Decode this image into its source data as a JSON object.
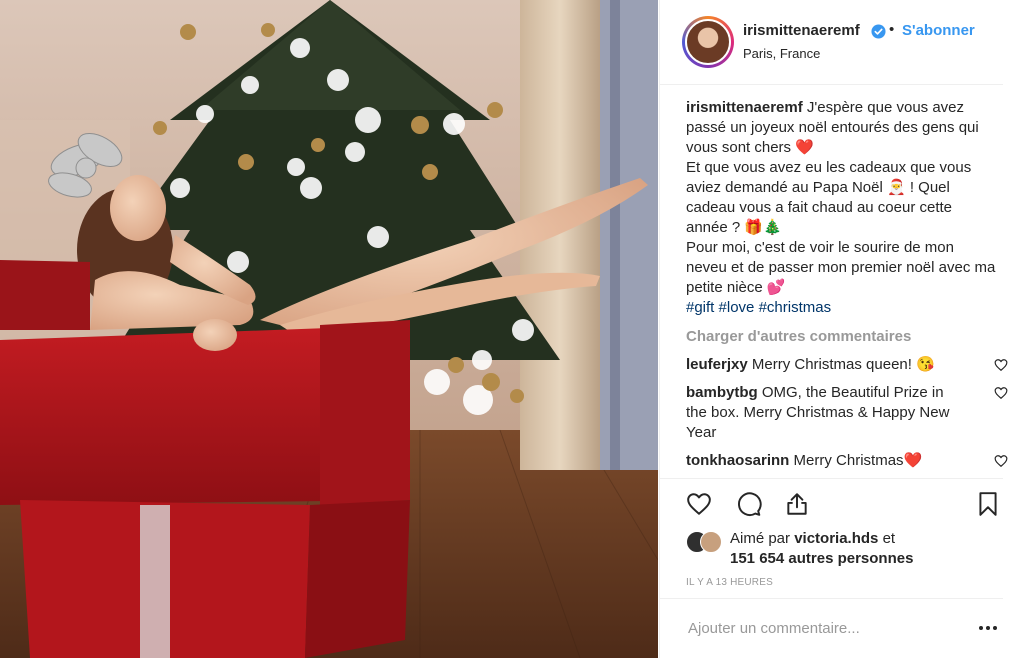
{
  "post": {
    "username": "irismittenaeremf",
    "follow_label": "S'abonner",
    "dot": "•",
    "location": "Paris, France"
  },
  "caption": {
    "username": "irismittenaeremf",
    "line1": "J'espère que vous avez passé un joyeux noël entourés des gens qui vous sont chers ❤️",
    "line2": "Et que vous avez eu les cadeaux que vous aviez demandé au Papa Noël 🎅 ! Quel cadeau vous a fait chaud au coeur cette année ? 🎁🎄",
    "line3": "Pour moi, c'est de voir le sourire de mon neveu et de passer mon premier noël avec ma petite nièce 💕",
    "hashtags": [
      "#gift",
      "#love",
      "#christmas"
    ]
  },
  "load_more_label": "Charger d'autres commentaires",
  "comments": [
    {
      "username": "leuferjxy",
      "text": "Merry Christmas queen! 😘"
    },
    {
      "username": "bambytbg",
      "text": "OMG, the Beautiful Prize in the box. Merry Christmas & Happy New Year"
    },
    {
      "username": "tonkhaosarinn",
      "text": "Merry Christmas❤️"
    }
  ],
  "likes": {
    "prefix": "Aimé par",
    "first_liker": "victoria.hds",
    "connector": "et",
    "others": "151 654 autres personnes"
  },
  "timestamp": "IL Y A 13 HEURES",
  "comment_input": {
    "placeholder": "Ajouter un commentaire..."
  },
  "icons": {
    "like": "heart-icon",
    "comment": "comment-bubble-icon",
    "share": "share-icon",
    "save": "bookmark-icon",
    "more": "more-dots-icon",
    "verified": "verified-badge-icon"
  },
  "colors": {
    "link": "#3897f0",
    "hashtag": "#003569",
    "muted": "#999999",
    "text": "#262626",
    "gift_red": "#b5151b"
  }
}
